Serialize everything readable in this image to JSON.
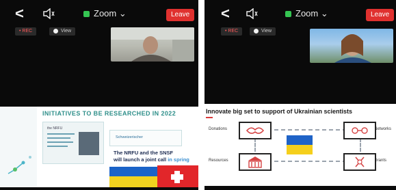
{
  "colors": {
    "accent_red": "#e0312f",
    "shield_green": "#35c552",
    "slide_teal": "#2f8f8a",
    "callout_blue": "#3a8fd1"
  },
  "left_screen": {
    "meeting": "Zoom",
    "leave_label": "Leave",
    "chip_rec": "• REC",
    "chip_view": "View",
    "slide": {
      "title": "INITIATIVES TO BE RESEARCHED IN 2022",
      "callout_line1": "The NRFU and the SNSF",
      "callout_line2_a": "will launch a joint call ",
      "callout_line2_b": "in spring",
      "card_small_text": "the NRFU",
      "logo_text": "Schweizerischer"
    }
  },
  "right_screen": {
    "meeting": "Zoom",
    "leave_label": "Leave",
    "chip_rec": "• REC",
    "chip_view": "View",
    "slide": {
      "title": "Innovate big set to support of Ukrainian scientists",
      "labels": {
        "top_left": "Donations",
        "top_right": "Networks",
        "bottom_left": "Resources",
        "bottom_right": "Grants"
      }
    }
  },
  "icons": [
    "back-icon",
    "speaker-icon",
    "shield-icon",
    "chevron-down-icon",
    "handshake-icon",
    "network-icon",
    "building-icon",
    "funding-icon"
  ]
}
